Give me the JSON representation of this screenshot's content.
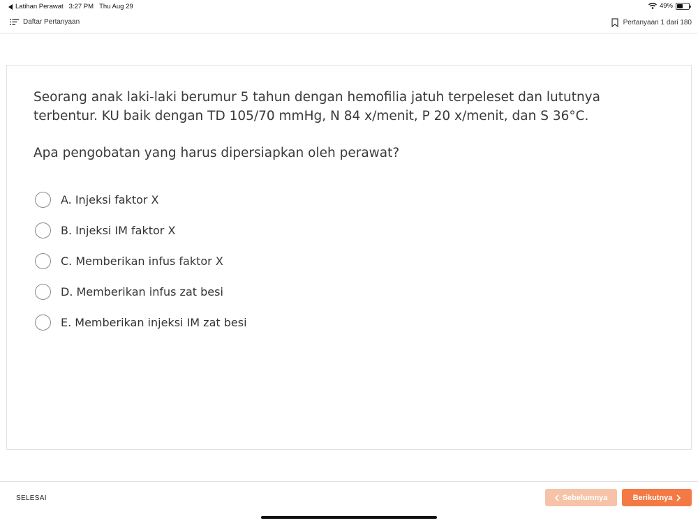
{
  "status_bar": {
    "back_app": "Latihan Perawat",
    "time": "3:27 PM",
    "date": "Thu Aug 29",
    "battery_percent": "49%",
    "battery_level": 0.49,
    "icons": {
      "back": "back-triangle-icon",
      "wifi": "wifi-icon",
      "battery": "battery-icon"
    }
  },
  "header": {
    "question_list_label": "Daftar Pertanyaan",
    "question_counter": "Pertanyaan 1 dari 180",
    "icons": {
      "list": "list-icon",
      "bookmark": "bookmark-icon"
    }
  },
  "question": {
    "text": "Seorang anak laki-laki berumur 5 tahun dengan hemofilia jatuh terpeleset dan lututnya terbentur. KU baik dengan TD 105/70 mmHg, N 84 x/menit, P 20 x/menit, dan S 36°C.",
    "prompt": "Apa pengobatan yang harus dipersiapkan oleh perawat?",
    "options": [
      {
        "label": "A. Injeksi faktor X"
      },
      {
        "label": "B. Injeksi IM faktor X"
      },
      {
        "label": "C. Memberikan infus faktor X"
      },
      {
        "label": "D. Memberikan infus zat besi"
      },
      {
        "label": "E. Memberikan injeksi IM zat besi"
      }
    ]
  },
  "footer": {
    "finish_label": "SELESAI",
    "prev_label": "Sebelumnya",
    "next_label": "Berikutnya",
    "icons": {
      "prev": "chevron-left-icon",
      "next": "chevron-right-icon"
    }
  },
  "colors": {
    "accent": "#f47a45",
    "accent_disabled": "#f7c3a8",
    "text": "#333333",
    "border": "#e2e2e2"
  }
}
